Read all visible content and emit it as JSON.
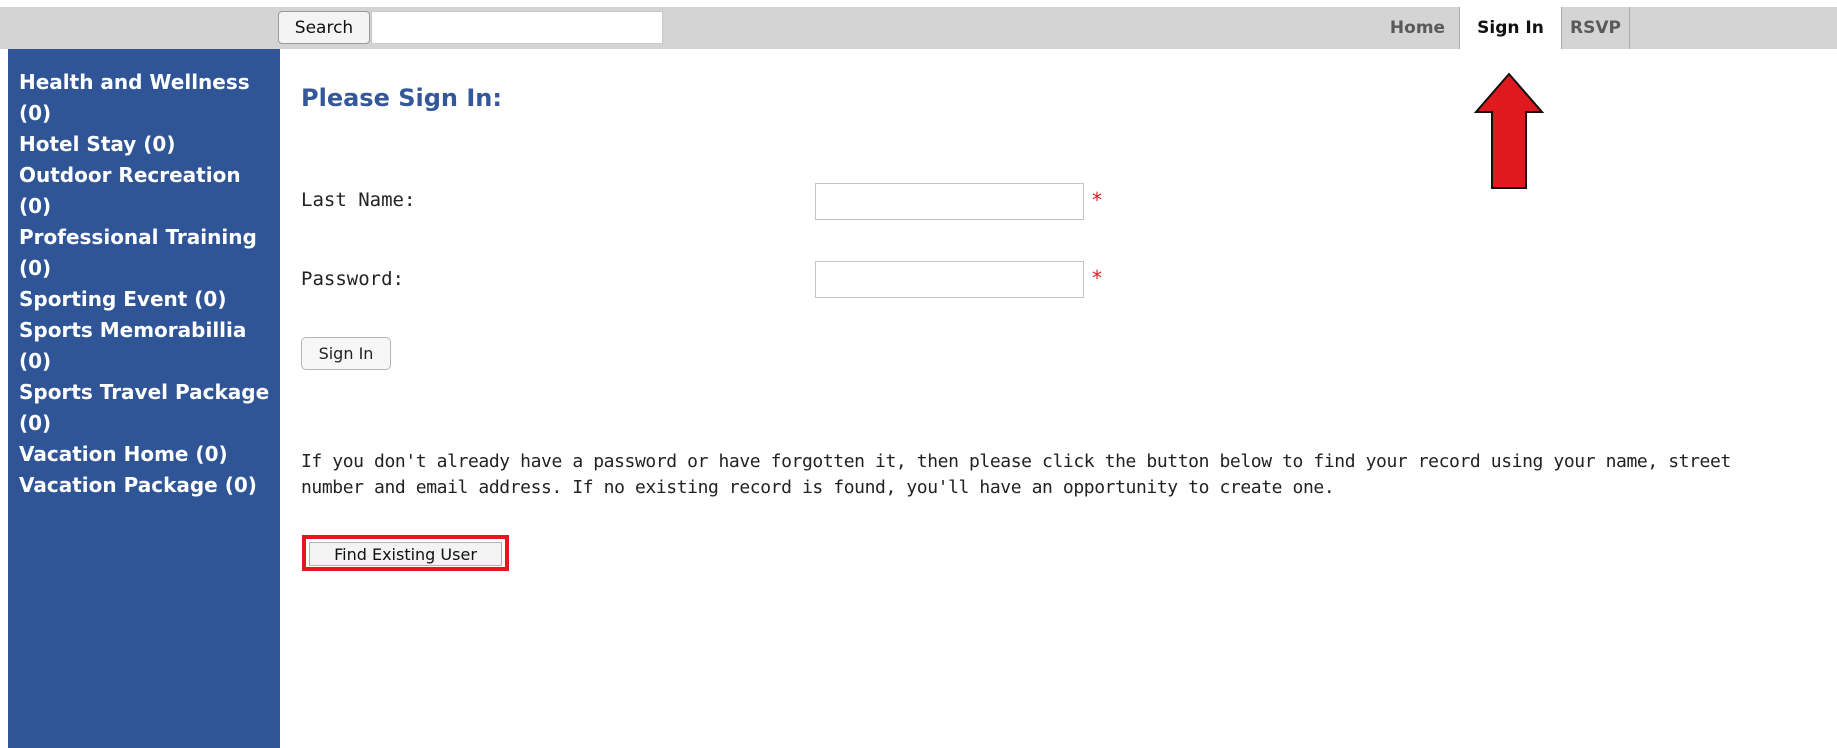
{
  "topbar": {
    "search_label": "Search",
    "search_value": "",
    "nav": [
      "Home",
      "Sign In",
      "RSVP"
    ],
    "active_nav": "Sign In"
  },
  "sidebar": {
    "items": [
      "Health and Wellness (0)",
      "Hotel Stay (0)",
      "Outdoor Recreation (0)",
      "Professional Training (0)",
      "Sporting Event (0)",
      "Sports Memorabillia (0)",
      "Sports Travel Package (0)",
      "Vacation Home (0)",
      "Vacation Package (0)"
    ]
  },
  "form": {
    "title": "Please Sign In:",
    "last_name_label": "Last Name:",
    "password_label": "Password:",
    "required_marker": "*",
    "last_name_value": "",
    "password_value": "",
    "sign_in_button": "Sign In"
  },
  "info": {
    "text": "If you don't already have a password or have forgotten it, then please click the button below to find your record using your name, street number and email address. If no existing record is found, you'll have an opportunity to create one.",
    "find_button": "Find Existing User"
  },
  "colors": {
    "sidebar_bg": "#2f5597",
    "title": "#34579a",
    "topbar_bg": "#d4d4d4",
    "required": "#cc2222",
    "annotation": "#e0191f"
  }
}
